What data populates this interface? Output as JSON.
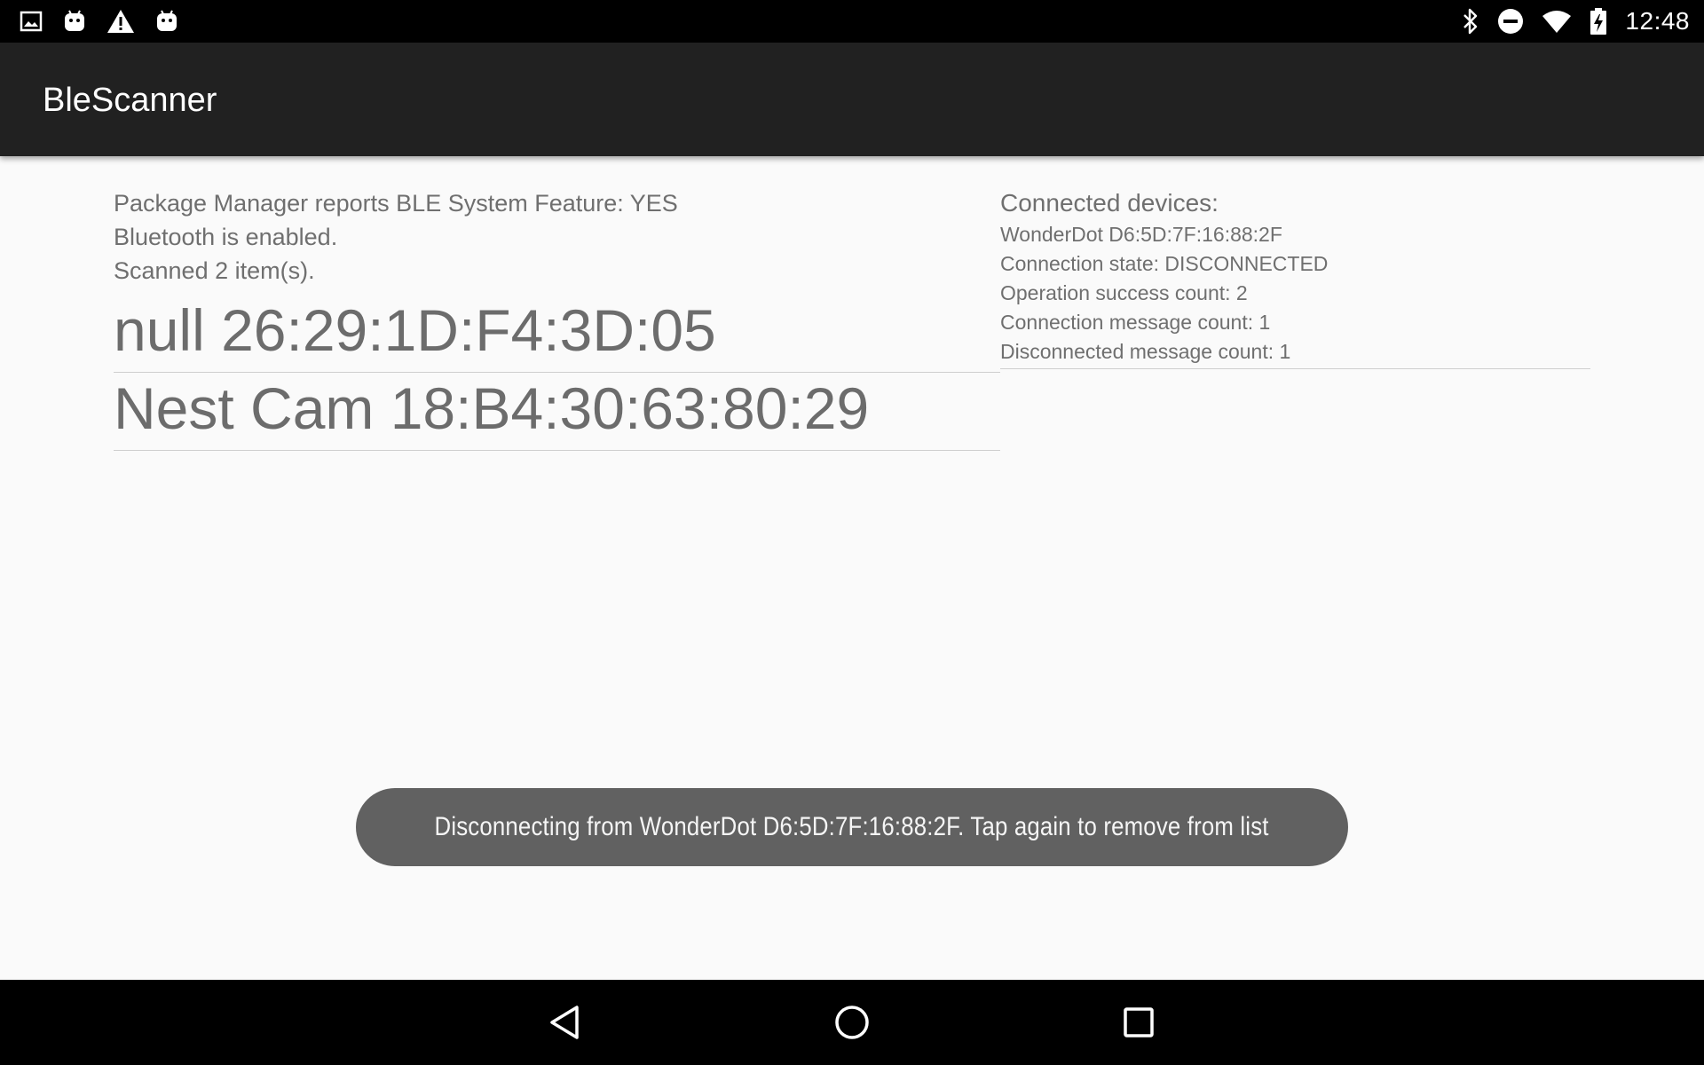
{
  "status_bar": {
    "time": "12:48",
    "left_icons": [
      "image-notification-icon",
      "android-notification-icon",
      "warning-notification-icon",
      "android-notification-icon"
    ],
    "right_icons": [
      "bluetooth-icon",
      "do-not-disturb-icon",
      "wifi-icon",
      "battery-charging-icon"
    ]
  },
  "app_bar": {
    "title": "BleScanner"
  },
  "scan_info": {
    "feature_line": "Package Manager reports BLE System Feature: YES",
    "bluetooth_line": "Bluetooth is enabled.",
    "scanned_line": "Scanned 2 item(s)."
  },
  "scanned_devices": [
    {
      "label": "null 26:29:1D:F4:3D:05"
    },
    {
      "label": "Nest Cam 18:B4:30:63:80:29"
    }
  ],
  "connected": {
    "heading": "Connected devices:",
    "device": {
      "name_address": "WonderDot D6:5D:7F:16:88:2F",
      "state": "Connection state: DISCONNECTED",
      "success_count": "Operation success count: 2",
      "connection_msg_count": "Connection message count: 1",
      "disconnected_msg_count": "Disconnected message count: 1"
    }
  },
  "toast": {
    "message": "Disconnecting from  WonderDot D6:5D:7F:16:88:2F.  Tap again to remove from list"
  },
  "nav_bar": {
    "buttons": [
      "back-icon",
      "home-icon",
      "recents-icon"
    ]
  },
  "colors": {
    "status_bar": "#000000",
    "app_bar": "#212121",
    "background": "#fafafa",
    "text_secondary": "#6f6f6f",
    "toast": "#616161",
    "divider": "#cfcfcf"
  }
}
